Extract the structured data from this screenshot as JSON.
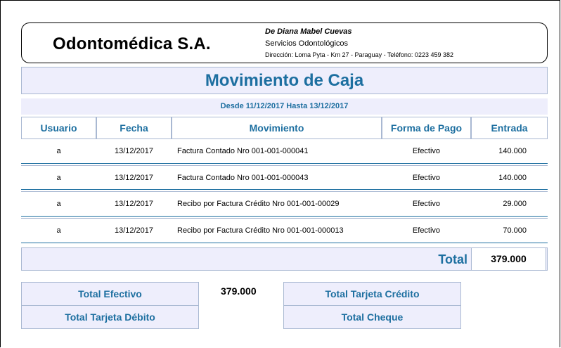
{
  "header": {
    "company": "Odontomédica S.A.",
    "owner": "De Diana Mabel Cuevas",
    "services": "Servicios Odontológicos",
    "address": "Dirección: Loma Pyta - Km 27 - Paraguay  -  Teléfono: 0223 459 382"
  },
  "report": {
    "title": "Movimiento de Caja",
    "range": "Desde 11/12/2017 Hasta 13/12/2017"
  },
  "columns": [
    "Usuario",
    "Fecha",
    "Movimiento",
    "Forma de Pago",
    "Entrada"
  ],
  "rows": [
    {
      "usuario": "a",
      "fecha": "13/12/2017",
      "movimiento": "Factura Contado Nro 001-001-000041",
      "forma": "Efectivo",
      "entrada": "140.000"
    },
    {
      "usuario": "a",
      "fecha": "13/12/2017",
      "movimiento": "Factura Contado Nro 001-001-000043",
      "forma": "Efectivo",
      "entrada": "140.000"
    },
    {
      "usuario": "a",
      "fecha": "13/12/2017",
      "movimiento": "Recibo por Factura Crédito Nro 001-001-00029",
      "forma": "Efectivo",
      "entrada": "29.000"
    },
    {
      "usuario": "a",
      "fecha": "13/12/2017",
      "movimiento": "Recibo por Factura Crédito Nro 001-001-000013",
      "forma": "Efectivo",
      "entrada": "70.000"
    }
  ],
  "total": {
    "label": "Total",
    "value": "379.000"
  },
  "summary": {
    "efectivo_label": "Total Efectivo",
    "efectivo_value": "379.000",
    "tarjeta_credito_label": "Total Tarjeta Crédito",
    "tarjeta_debito_label": "Total Tarjeta Débito",
    "cheque_label": "Total Cheque"
  },
  "colors": {
    "accent": "#1d6fa0",
    "panel": "#eeeefc",
    "border": "#a9b8d2"
  }
}
